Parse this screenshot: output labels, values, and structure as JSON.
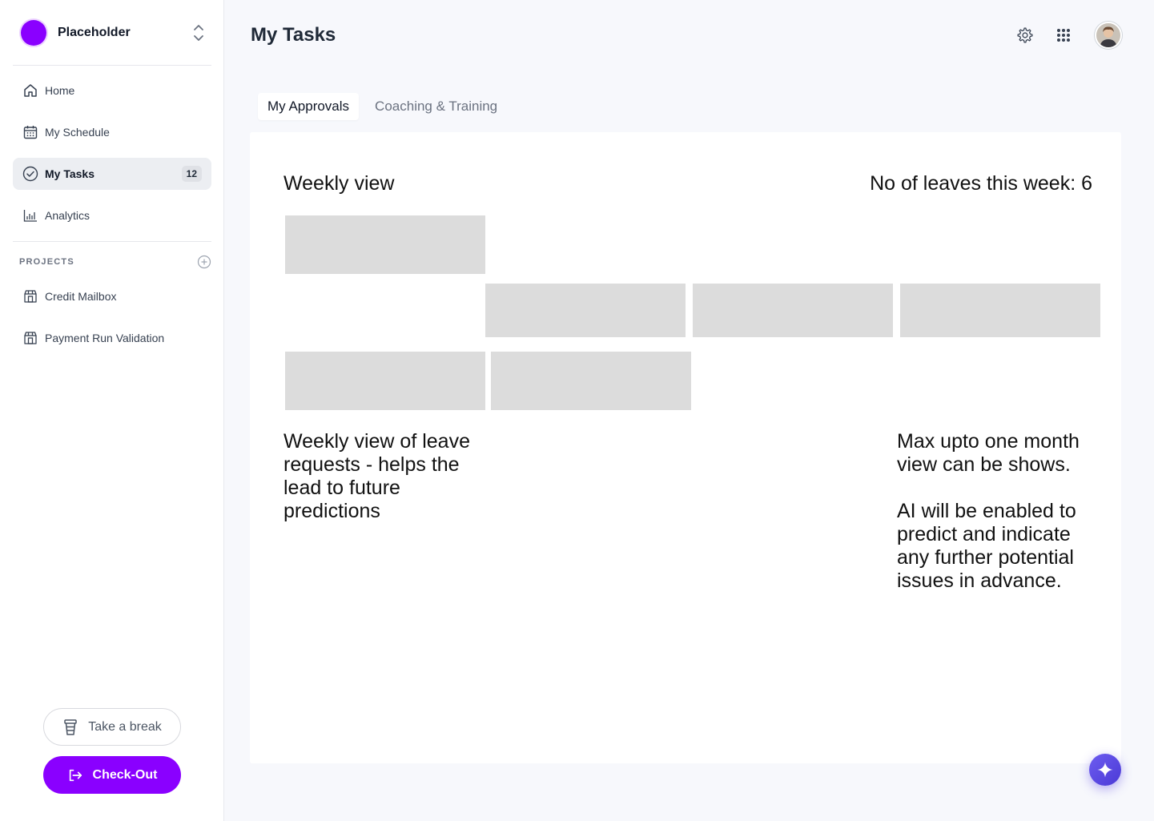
{
  "workspace": {
    "name": "Placeholder",
    "color": "#8a00ff"
  },
  "nav": {
    "items": [
      {
        "label": "Home",
        "icon": "home-icon"
      },
      {
        "label": "My Schedule",
        "icon": "calendar-icon"
      },
      {
        "label": "My Tasks",
        "icon": "check-circle-icon",
        "badge": "12",
        "active": true
      },
      {
        "label": "Analytics",
        "icon": "bar-chart-icon"
      }
    ]
  },
  "projects": {
    "title": "PROJECTS",
    "items": [
      {
        "label": "Credit Mailbox",
        "icon": "store-icon"
      },
      {
        "label": "Payment Run Validation",
        "icon": "store-icon"
      }
    ]
  },
  "actions": {
    "break_label": "Take a break",
    "checkout_label": "Check-Out"
  },
  "header": {
    "title": "My Tasks"
  },
  "tabs": [
    {
      "label": "My Approvals",
      "active": true
    },
    {
      "label": "Coaching & Training",
      "active": false
    }
  ],
  "panel": {
    "title": "Weekly view",
    "count_label": "No of leaves this week: 6",
    "note_left": "Weekly view of leave\nrequests - helps the\nlead to future\npredictions",
    "note_right": "Max upto one month\nview can be shows.\n\nAI will be enabled to\npredict and indicate\nany further potential\nissues in advance."
  },
  "colors": {
    "accent": "#8a00ff",
    "placeholder_block": "#dcdcdc",
    "fab": "#5b48e6"
  }
}
